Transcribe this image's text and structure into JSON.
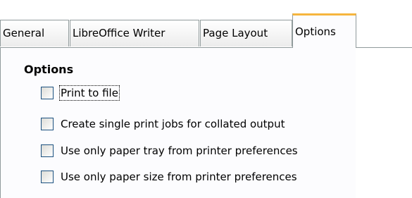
{
  "tabs": [
    {
      "label": "General"
    },
    {
      "label": "LibreOffice Writer"
    },
    {
      "label": "Page Layout"
    },
    {
      "label": "Options"
    }
  ],
  "options": {
    "heading": "Options",
    "items": [
      {
        "label": "Print to file",
        "checked": false
      },
      {
        "label": "Create single print jobs for collated output",
        "checked": false
      },
      {
        "label": "Use only paper tray from printer preferences",
        "checked": false
      },
      {
        "label": "Use only paper size from printer preferences",
        "checked": false
      }
    ]
  }
}
